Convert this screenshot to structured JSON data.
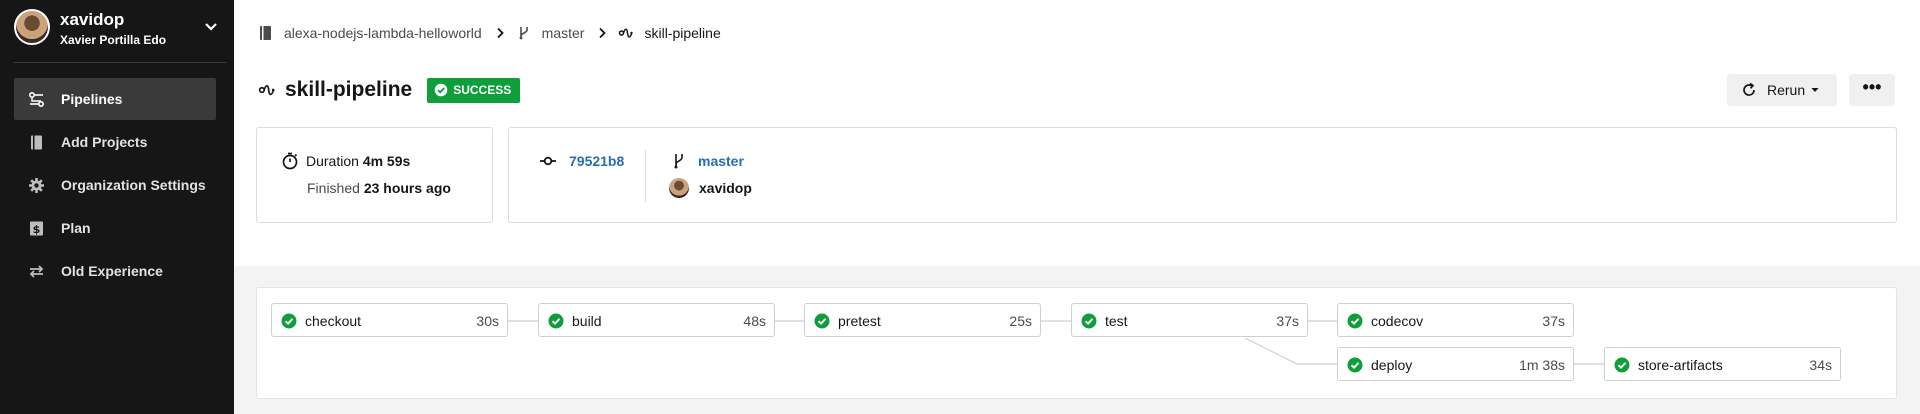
{
  "sidebar": {
    "username": "xavidop",
    "fullname": "Xavier Portilla Edo",
    "items": [
      {
        "label": "Pipelines",
        "icon": "pipelines-icon",
        "active": true
      },
      {
        "label": "Add Projects",
        "icon": "book-icon",
        "active": false
      },
      {
        "label": "Organization Settings",
        "icon": "gear-icon",
        "active": false
      },
      {
        "label": "Plan",
        "icon": "dollar-icon",
        "active": false
      },
      {
        "label": "Old Experience",
        "icon": "switch-arrows-icon",
        "active": false
      }
    ]
  },
  "breadcrumb": {
    "project": "alexa-nodejs-lambda-helloworld",
    "branch": "master",
    "workflow": "skill-pipeline"
  },
  "header": {
    "title": "skill-pipeline",
    "status": "SUCCESS",
    "rerun_label": "Rerun",
    "more_label": "•••"
  },
  "summary": {
    "duration_label": "Duration",
    "duration_value": "4m 59s",
    "finished_label": "Finished",
    "finished_value": "23 hours ago",
    "commit": "79521b8",
    "branch": "master",
    "author": "xavidop"
  },
  "jobs": [
    {
      "name": "checkout",
      "time": "30s",
      "status": "success"
    },
    {
      "name": "build",
      "time": "48s",
      "status": "success"
    },
    {
      "name": "pretest",
      "time": "25s",
      "status": "success"
    },
    {
      "name": "test",
      "time": "37s",
      "status": "success"
    },
    {
      "name": "codecov",
      "time": "37s",
      "status": "success"
    },
    {
      "name": "deploy",
      "time": "1m 38s",
      "status": "success"
    },
    {
      "name": "store-artifacts",
      "time": "34s",
      "status": "success"
    }
  ],
  "colors": {
    "sidebar_bg": "#161616",
    "success": "#0e9f3b",
    "link": "#2a6db1"
  }
}
